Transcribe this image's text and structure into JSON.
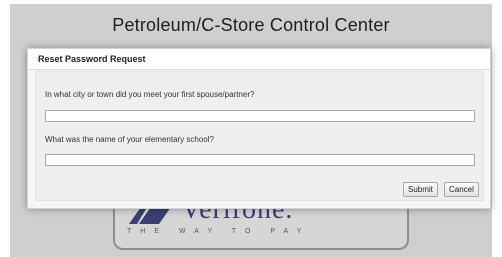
{
  "app": {
    "title": "Petroleum/C-Store Control Center"
  },
  "branding": {
    "logo_text": "Verifone.",
    "tagline": "THE WAY TO PAY"
  },
  "dialog": {
    "title": "Reset Password Request",
    "question1": {
      "label": "In what city or town did you meet your first spouse/partner?",
      "value": ""
    },
    "question2": {
      "label": "What was the name of your elementary school?",
      "value": ""
    },
    "submit_label": "Submit",
    "cancel_label": "Cancel"
  },
  "colors": {
    "brand": "#3a3e72",
    "backdrop": "#cfcfcf"
  }
}
